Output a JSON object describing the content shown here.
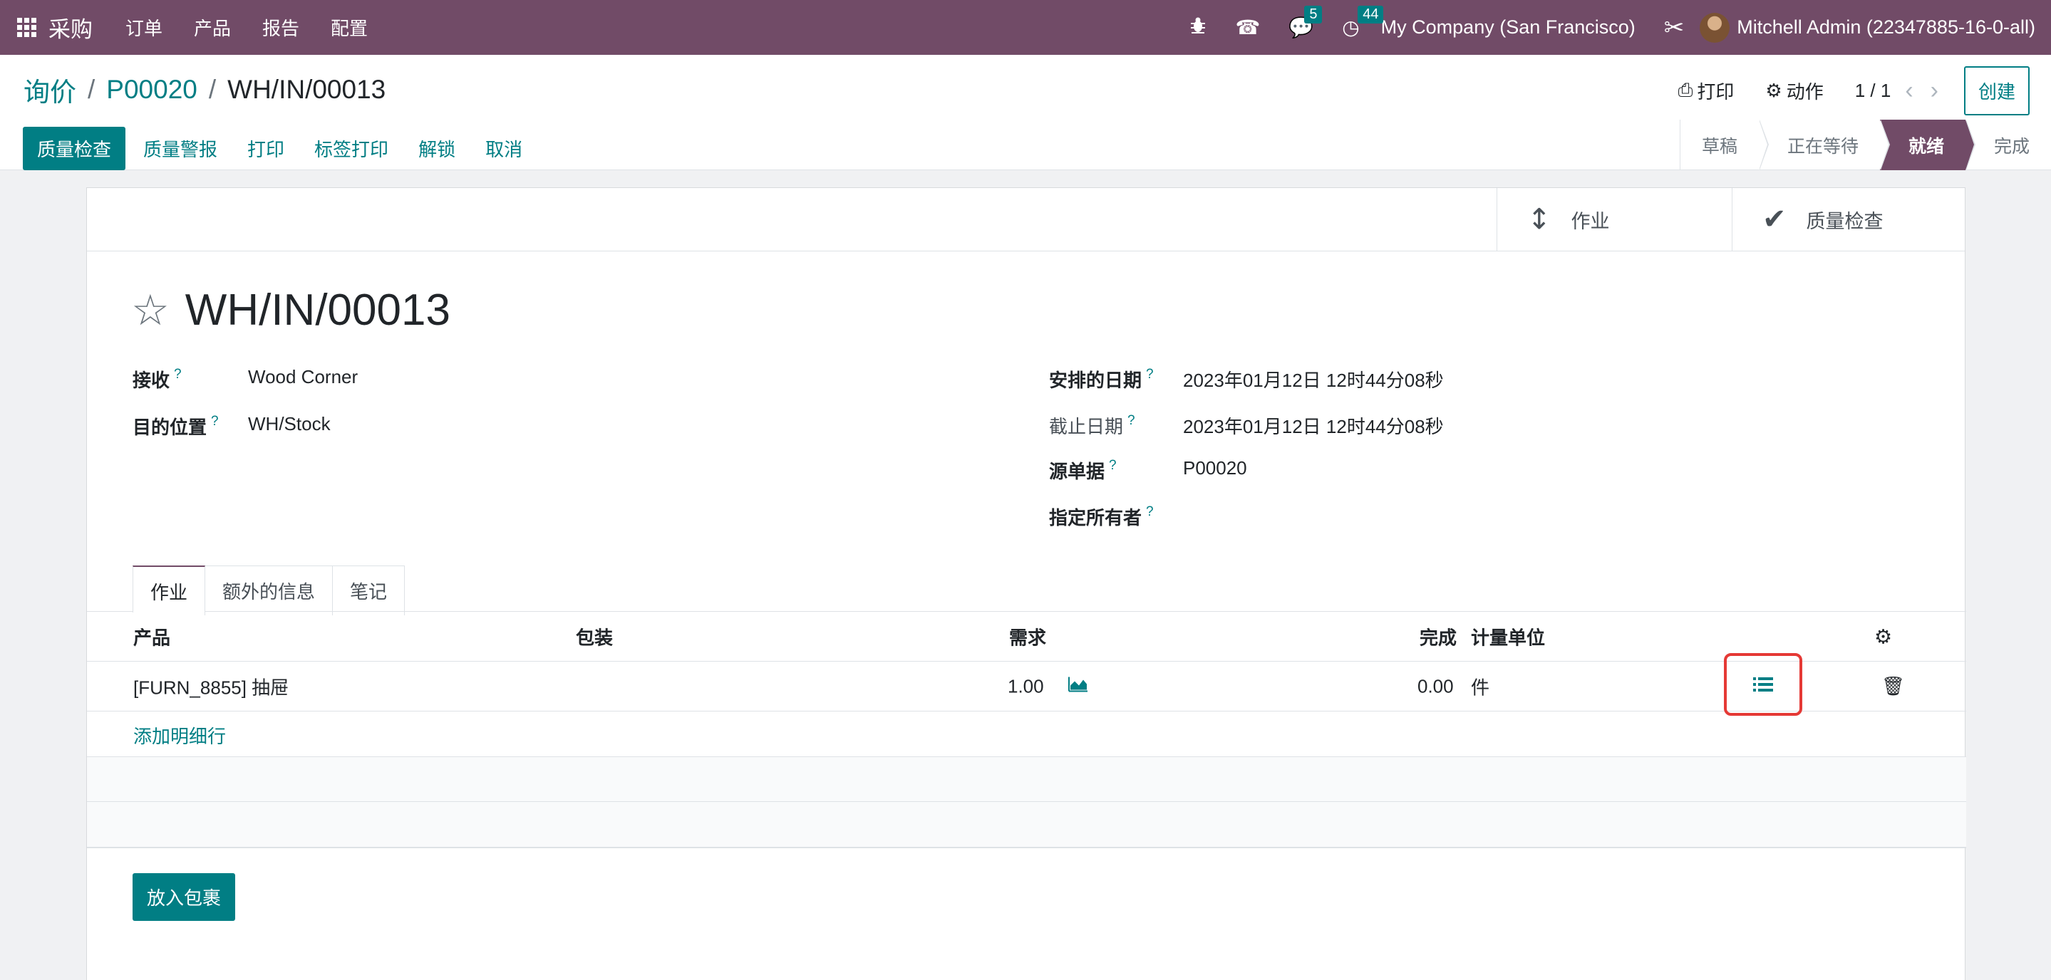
{
  "navbar": {
    "app_name": "采购",
    "menus": [
      "订单",
      "产品",
      "报告",
      "配置"
    ],
    "chat_count": "5",
    "activity_count": "44",
    "company": "My Company (San Francisco)",
    "user": "Mitchell Admin (22347885-16-0-all)"
  },
  "breadcrumb": {
    "items": [
      "询价",
      "P00020"
    ],
    "current": "WH/IN/00013"
  },
  "control": {
    "print_label": "打印",
    "action_label": "动作",
    "pager": "1 / 1",
    "create_label": "创建"
  },
  "buttons": {
    "quality_check": "质量检查",
    "quality_alert": "质量警报",
    "print": "打印",
    "label_print": "标签打印",
    "unlock": "解锁",
    "cancel": "取消"
  },
  "statusbar": [
    "草稿",
    "正在等待",
    "就绪",
    "完成"
  ],
  "smart_buttons": {
    "operations": "作业",
    "quality_checks": "质量检查"
  },
  "record": {
    "title": "WH/IN/00013",
    "receive_from_label": "接收",
    "receive_from": "Wood Corner",
    "destination_label": "目的位置",
    "destination": "WH/Stock",
    "scheduled_date_label": "安排的日期",
    "scheduled_date": "2023年01月12日 12时44分08秒",
    "deadline_label": "截止日期",
    "deadline": "2023年01月12日 12时44分08秒",
    "source_label": "源单据",
    "source": "P00020",
    "owner_label": "指定所有者",
    "help_mark": "?"
  },
  "tabs": [
    "作业",
    "额外的信息",
    "笔记"
  ],
  "table": {
    "headers": {
      "product": "产品",
      "packaging": "包装",
      "demand": "需求",
      "done": "完成",
      "uom": "计量单位"
    },
    "rows": [
      {
        "product": "[FURN_8855] 抽屉",
        "demand": "1.00",
        "done": "0.00",
        "uom": "件"
      }
    ],
    "add_line": "添加明细行"
  },
  "put_in_pack": "放入包裹",
  "colors": {
    "brand": "#714b67",
    "accent": "#017e84",
    "highlight": "#e53935"
  }
}
